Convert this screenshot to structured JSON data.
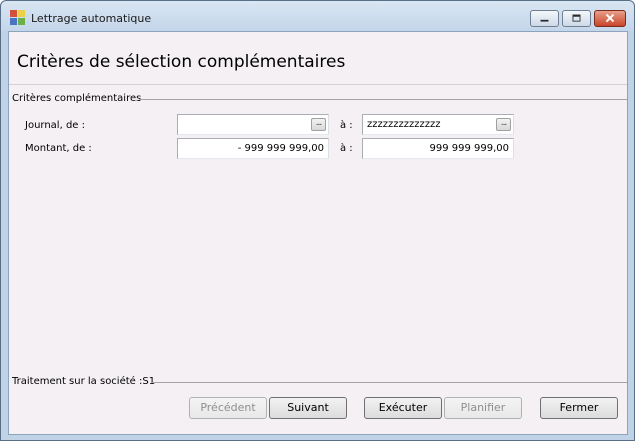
{
  "window": {
    "title": "Lettrage automatique"
  },
  "header": {
    "title": "Critères de sélection complémentaires"
  },
  "criteria": {
    "group_label": "Critères complémentaires",
    "journal": {
      "label": "Journal, de :",
      "from_value": "",
      "to_label": "à :",
      "to_value": "zzzzzzzzzzzzzz",
      "lookup_glyph": "..."
    },
    "montant": {
      "label": "Montant, de :",
      "from_value": "- 999 999 999,00",
      "to_label": "à :",
      "to_value": "999 999 999,00"
    }
  },
  "footer": {
    "label": "Traitement sur la société :S1"
  },
  "buttons": {
    "previous": "Précédent",
    "next": "Suivant",
    "execute": "Exécuter",
    "schedule": "Planifier",
    "close": "Fermer"
  },
  "colors": {
    "client_background": "#f4f0f4",
    "close_button": "#c8442a"
  }
}
